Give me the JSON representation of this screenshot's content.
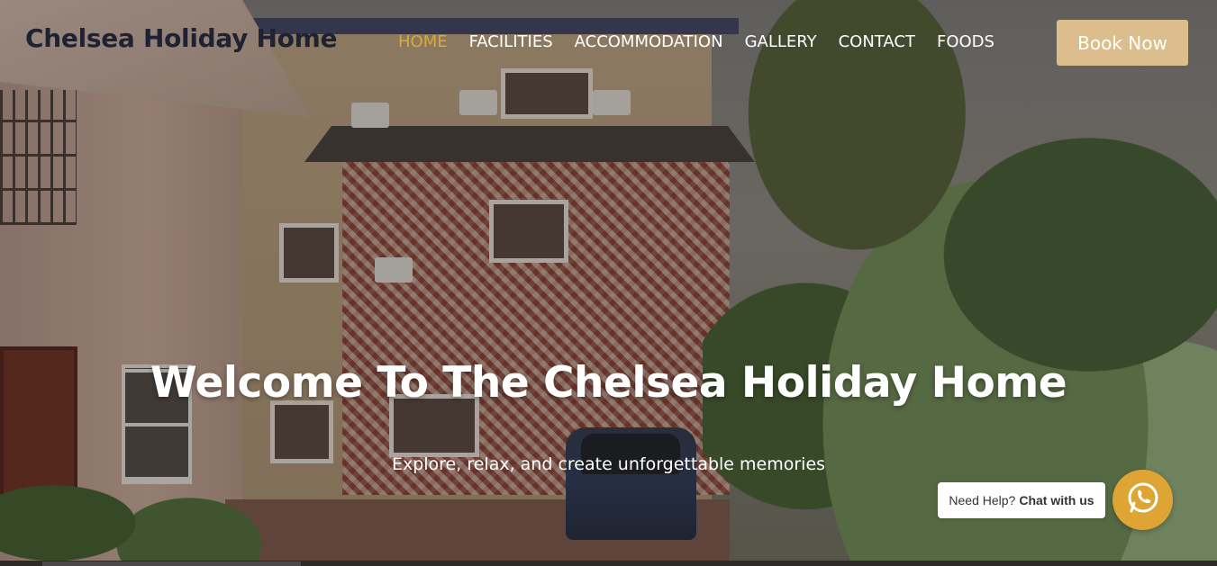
{
  "header": {
    "logo_text": "Chelsea Holiday Home",
    "nav": [
      {
        "label": "HOME",
        "active": true
      },
      {
        "label": "FACILITIES",
        "active": false
      },
      {
        "label": "ACCOMMODATION",
        "active": false
      },
      {
        "label": "GALLERY",
        "active": false
      },
      {
        "label": "CONTACT",
        "active": false
      },
      {
        "label": "FOODS",
        "active": false
      }
    ],
    "book_button_label": "Book Now"
  },
  "hero": {
    "title": "Welcome To The Chelsea Holiday Home",
    "subtitle": "Explore, relax, and create unforgettable memories"
  },
  "chat": {
    "prompt_prefix": "Need Help?",
    "prompt_action": "Chat with us",
    "icon": "whatsapp-icon"
  },
  "colors": {
    "accent_active": "#d9a93c",
    "book_button_bg": "#dcbd8c",
    "whatsapp_bg": "#dfa534",
    "logo_color": "#1f2235"
  }
}
